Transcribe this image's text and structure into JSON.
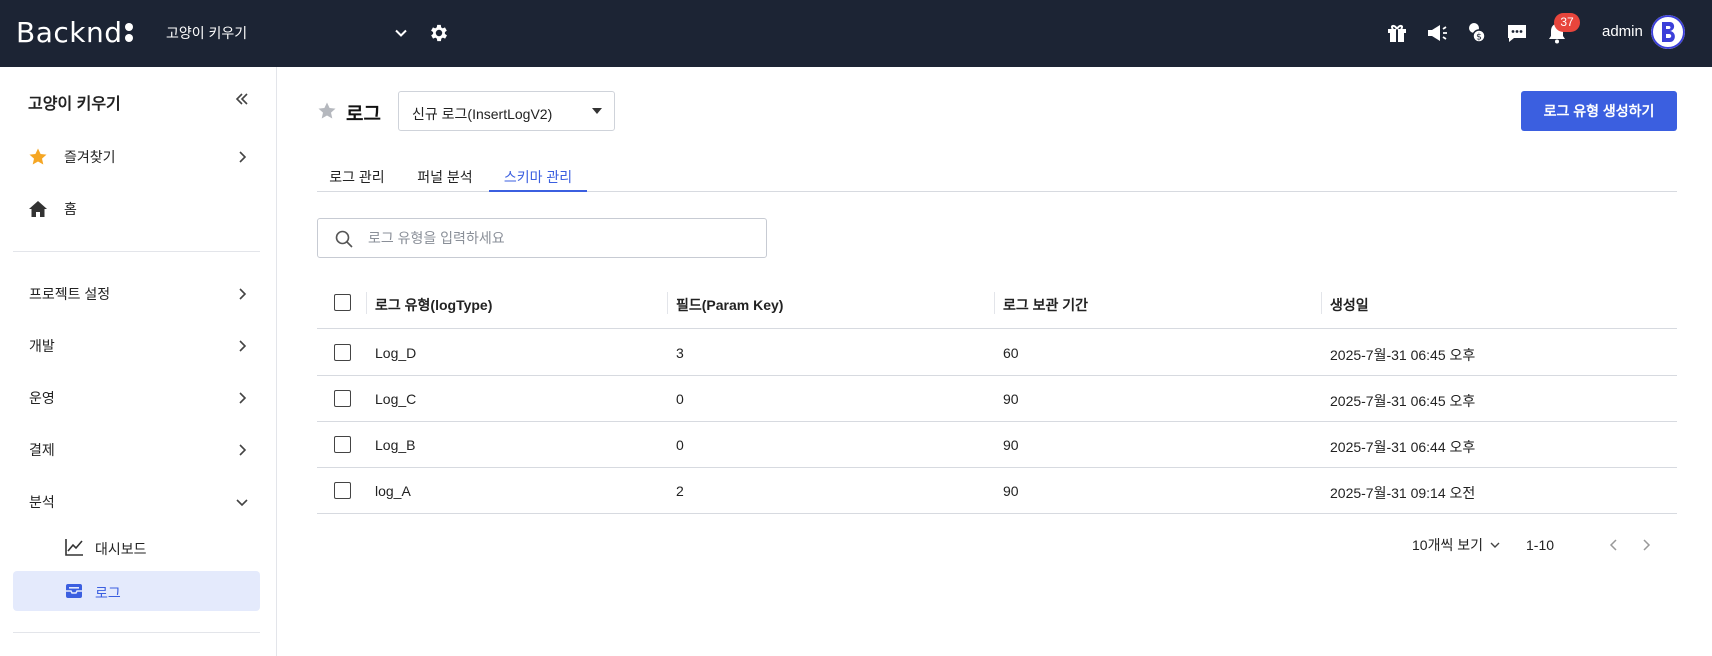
{
  "header": {
    "logo_text": "Backnd",
    "project_selector": "고양이 키우기",
    "notification_count": "37",
    "user_name": "admin",
    "icons": [
      "gift-icon",
      "megaphone-icon",
      "coins-icon",
      "chat-icon",
      "bell-icon"
    ]
  },
  "sidebar": {
    "title": "고양이 키우기",
    "favorites": "즐겨찾기",
    "home": "홈",
    "project_settings": "프로젝트 설정",
    "development": "개발",
    "operations": "운영",
    "payment": "결제",
    "analytics": "분석",
    "dashboard": "대시보드",
    "logs": "로그"
  },
  "main": {
    "title": "로그",
    "log_version_select": "신규 로그(InsertLogV2)",
    "create_button": "로그 유형 생성하기",
    "tabs": [
      {
        "label": "로그 관리",
        "active": false
      },
      {
        "label": "퍼널 분석",
        "active": false
      },
      {
        "label": "스키마 관리",
        "active": true
      }
    ],
    "search_placeholder": "로그 유형을 입력하세요"
  },
  "table": {
    "columns": [
      "로그 유형(logType)",
      "필드(Param Key)",
      "로그 보관 기간",
      "생성일"
    ],
    "rows": [
      {
        "type": "Log_D",
        "fields": "3",
        "retention": "60",
        "created": "2025-7월-31 06:45 오후"
      },
      {
        "type": "Log_C",
        "fields": "0",
        "retention": "90",
        "created": "2025-7월-31 06:45 오후"
      },
      {
        "type": "Log_B",
        "fields": "0",
        "retention": "90",
        "created": "2025-7월-31 06:44 오후"
      },
      {
        "type": "log_A",
        "fields": "2",
        "retention": "90",
        "created": "2025-7월-31 09:14 오전"
      }
    ]
  },
  "pagination": {
    "per_page": "10개씩 보기",
    "range": "1-10"
  },
  "colors": {
    "topbar": "#1c2434",
    "accent": "#3b5fe0",
    "active_item_bg": "#e4eafc",
    "badge": "#e8453c",
    "star": "#f5a623"
  }
}
